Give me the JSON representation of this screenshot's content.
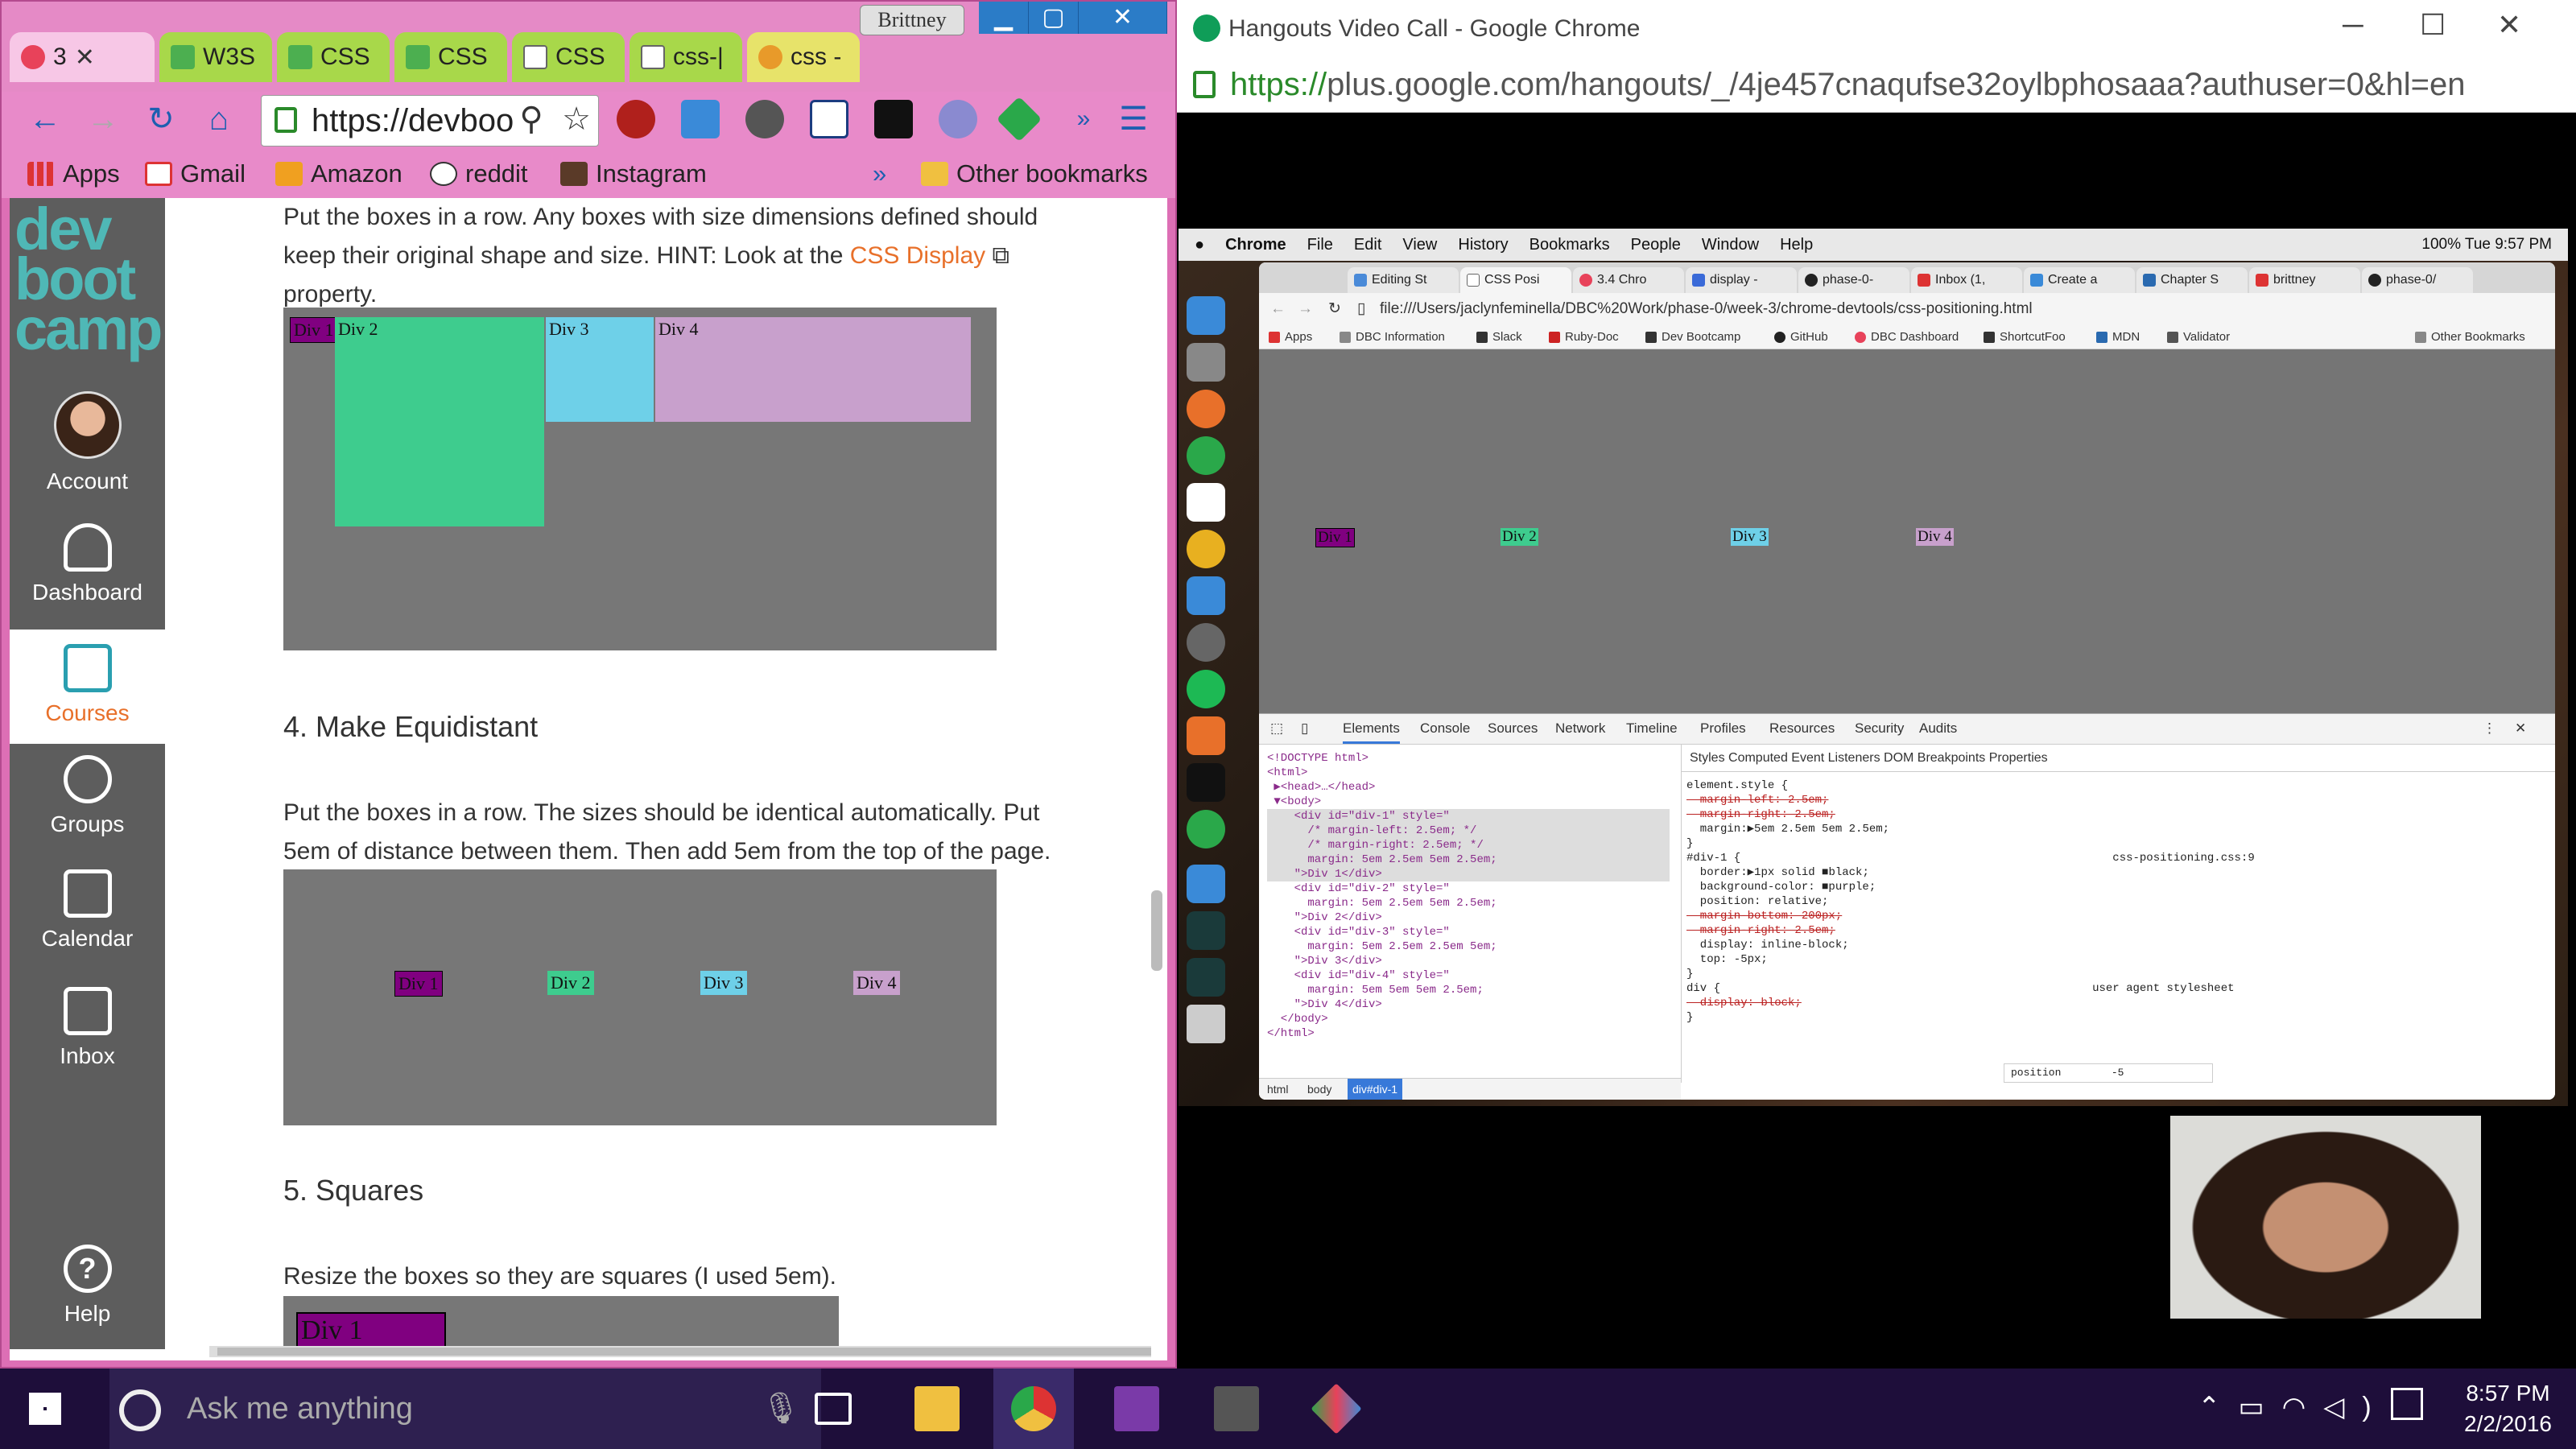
{
  "left_window": {
    "tabs": [
      {
        "label": "3",
        "icon": "devbootcamp-icon",
        "active": true
      },
      {
        "label": "W3S",
        "icon": "w3schools-icon"
      },
      {
        "label": "CSS",
        "icon": "w3schools-icon"
      },
      {
        "label": "CSS",
        "icon": "w3schools-icon"
      },
      {
        "label": "CSS",
        "icon": "document-icon"
      },
      {
        "label": "css-|",
        "icon": "document-icon"
      },
      {
        "label": "css -",
        "icon": "tag-icon"
      }
    ],
    "profile_name": "Brittney",
    "address": "https://devboo",
    "bookmarks": [
      "Apps",
      "Gmail",
      "Amazon",
      "reddit",
      "Instagram",
      "»",
      "Other bookmarks"
    ]
  },
  "sidebar": {
    "logo": "dev boot camp",
    "items": [
      {
        "label": "Account"
      },
      {
        "label": "Dashboard"
      },
      {
        "label": "Courses"
      },
      {
        "label": "Groups"
      },
      {
        "label": "Calendar"
      },
      {
        "label": "Inbox"
      },
      {
        "label": "Help"
      }
    ]
  },
  "content": {
    "intro_line1": "Put the boxes in a row. Any boxes with size dimensions defined should",
    "intro_line2_a": "keep their original shape and size. HINT: Look at the ",
    "intro_link": "CSS Display",
    "intro_line3": "property.",
    "section4_title": "4. Make Equidistant",
    "section4_text1": "Put the boxes in a row. The sizes should be identical automatically. Put",
    "section4_text2": "5em of distance between them. Then add 5em from the top of the page.",
    "section5_title": "5. Squares",
    "section5_text": "Resize the boxes so they are squares (I used 5em).",
    "div_labels": [
      "Div 1",
      "Div 2",
      "Div 3",
      "Div 4"
    ],
    "colors": {
      "div1": "#800080",
      "div2": "#3ecc8e",
      "div3": "#6ed0e8",
      "div4": "#c8a0cc",
      "demo_bg": "#777777"
    }
  },
  "right_window": {
    "title": "Hangouts Video Call - Google Chrome",
    "url_https": "https://",
    "url_rest": "plus.google.com/hangouts/_/4je457cnaqufse32oylbphosaaa?authuser=0&hl=en",
    "mac_menu": [
      "Chrome",
      "File",
      "Edit",
      "View",
      "History",
      "Bookmarks",
      "People",
      "Window",
      "Help"
    ],
    "mac_status": "100%   Tue 9:57 PM",
    "inner_tabs": [
      "Editing St",
      "CSS Posi",
      "3.4 Chro",
      "display -",
      "phase-0-",
      "Inbox (1,",
      "Create a",
      "Chapter S",
      "brittney",
      "phase-0/"
    ],
    "inner_url": "file:///Users/jaclynfeminella/DBC%20Work/phase-0/week-3/chrome-devtools/css-positioning.html",
    "inner_bookmarks": [
      "Apps",
      "DBC Information",
      "Slack",
      "Ruby-Doc",
      "Dev Bootcamp",
      "GitHub",
      "DBC Dashboard",
      "ShortcutFoo",
      "MDN",
      "Validator",
      "Other Bookmarks"
    ],
    "devtools_tabs": [
      "Elements",
      "Console",
      "Sources",
      "Network",
      "Timeline",
      "Profiles",
      "Resources",
      "Security",
      "Audits"
    ],
    "styles_tabs": "Styles   Computed   Event Listeners   DOM Breakpoints   Properties",
    "elements_code": [
      "<!DOCTYPE html>",
      "<html>",
      " ▶<head>…</head>",
      " ▼<body>",
      "    <div id=\"div-1\" style=\"",
      "      /* margin-left: 2.5em; */",
      "      /* margin-right: 2.5em; */",
      "      margin: 5em 2.5em 5em 2.5em;",
      "    \">Div 1</div>",
      "    <div id=\"div-2\" style=\"",
      "      margin: 5em 2.5em 5em 2.5em;",
      "    \">Div 2</div>",
      "    <div id=\"div-3\" style=\"",
      "      margin: 5em 2.5em 2.5em 5em;",
      "    \">Div 3</div>",
      "    <div id=\"div-4\" style=\"",
      "      margin: 5em 5em 5em 2.5em;",
      "    \">Div 4</div>",
      "  </body>",
      "</html>"
    ],
    "styles_code": [
      "element.style {",
      "  margin-left: 2.5em;",
      "  margin-right: 2.5em;",
      "  margin:▶5em 2.5em 5em 2.5em;",
      "}",
      "#div-1 {                                                       css-positioning.css:9",
      "  border:▶1px solid ■black;",
      "  background-color: ■purple;",
      "  position: relative;",
      "  margin-bottom: 200px;",
      "  margin-right: 2.5em;",
      "  display: inline-block;",
      "  top: -5px;",
      "}",
      "div {                                                       user agent stylesheet",
      "  display: block;",
      "}"
    ],
    "breadcrumb": [
      "html",
      "body",
      "div#div-1"
    ],
    "autocomplete": "position        -5"
  },
  "taskbar": {
    "search_placeholder": "Ask me anything",
    "time": "8:57 PM",
    "date": "2/2/2016"
  }
}
